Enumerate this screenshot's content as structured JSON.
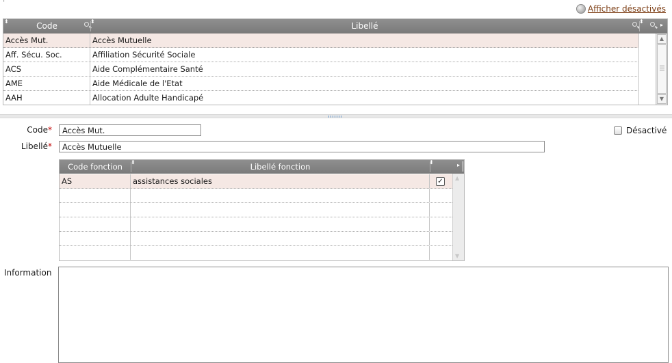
{
  "top_marker": ".",
  "show_disabled": {
    "label": "Afficher désactivés",
    "icon": "radio-circle-icon"
  },
  "grid": {
    "columns": {
      "code": "Code",
      "libelle": "Libellé"
    },
    "rows": [
      {
        "code": "Accès Mut.",
        "libelle": "Accès Mutuelle",
        "selected": true
      },
      {
        "code": "Aff. Sécu. Soc.",
        "libelle": "Affiliation Sécurité Sociale"
      },
      {
        "code": "ACS",
        "libelle": "Aide Complémentaire Santé"
      },
      {
        "code": "AME",
        "libelle": "Aide Médicale de l'Etat"
      },
      {
        "code": "AAH",
        "libelle": "Allocation Adulte Handicapé"
      }
    ]
  },
  "form": {
    "code_label": "Code",
    "code_value": "Accès Mut.",
    "libelle_label": "Libellé",
    "libelle_value": "Accès Mutuelle",
    "required_mark": "*",
    "disabled_label": "Désactivé",
    "information_label": "Information",
    "information_value": ""
  },
  "functions_grid": {
    "columns": {
      "code": "Code fonction",
      "libelle": "Libellé fonction"
    },
    "rows": [
      {
        "code": "AS",
        "libelle": "assistances sociales",
        "checked": true
      }
    ]
  },
  "colors": {
    "header": "#878787",
    "selected_row": "#f5e8e4",
    "link": "#7a3a10",
    "required": "#c00000"
  }
}
